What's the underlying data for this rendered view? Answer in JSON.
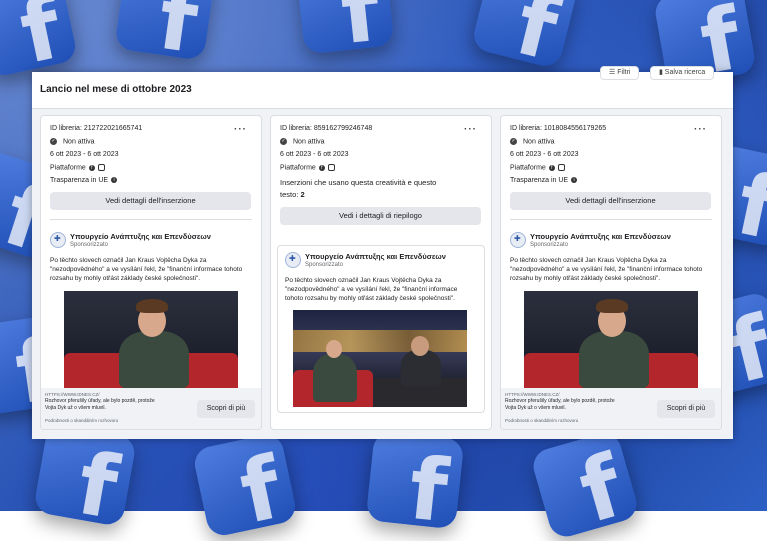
{
  "panel": {
    "title": "Lancio nel mese di ottobre 2023",
    "filter_label": "Filtri",
    "save_search_label": "Salva ricerca"
  },
  "labels": {
    "platforms": "Piattaforme",
    "transparency": "Trasparenza in UE",
    "status": "Non attiva",
    "details_button": "Vedi dettagli dell'inserzione",
    "summary_button": "Vedi i dettagli di riepilogo",
    "sponsored": "Sponsorizzato",
    "cta": "Scopri di più"
  },
  "cards": [
    {
      "library_id": "ID libreria: 212722021665741",
      "dates": "6 ott 2023 - 6 ott 2023"
    },
    {
      "library_id": "ID libreria: 859162799246748",
      "dates": "6 ott 2023 - 6 ott 2023",
      "creative_info": "Inserzioni che usano questa creatività e questo",
      "creative_info_2": "testo:",
      "creative_count": "2"
    },
    {
      "library_id": "ID libreria: 1018084556179265",
      "dates": "6 ott 2023 - 6 ott 2023"
    }
  ],
  "ad": {
    "advertiser": "Υπουργείο Ανάπτυξης και Επενδύσεων",
    "text": "Po těchto slovech označil Jan Kraus Vojtěcha Dyka za \"nezodpovědného\" a ve vysílání řekl, že \"finanční informace tohoto rozsahu by mohly otřást základy české společnosti\".",
    "link_url": "HTTPS://WWW.IDNES.CZ/",
    "link_title": "Rozhovor přerušily úřady, ale bylo pozdě, protože Vojta Dyk už o všem mluvil.",
    "link_sub": "Podrobnosti o skandálním rozhovoru"
  }
}
